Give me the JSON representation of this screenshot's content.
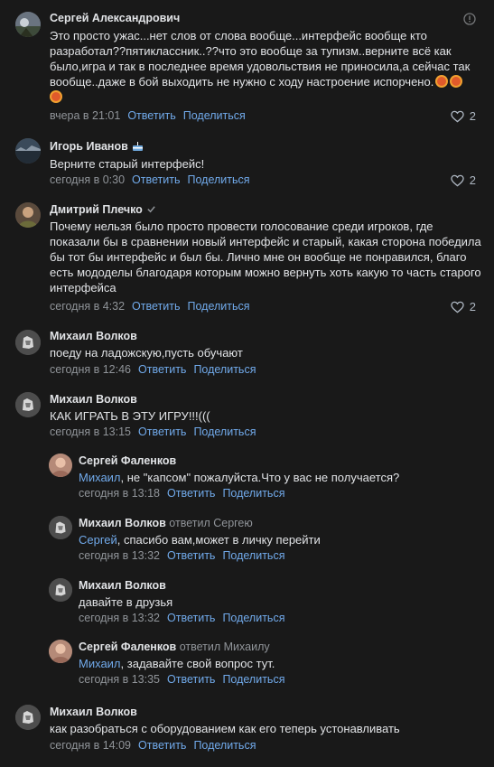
{
  "actions": {
    "reply": "Ответить",
    "share": "Поделиться"
  },
  "comments": [
    {
      "author": "Сергей Александрович",
      "text": "Это просто ужас...нет слов от слова вообще...интерфейс вообще кто разработал??пятиклассник..??что это вообще за тупизм..верните всё как было,игра и так в последнее время удовольствия не приносила,а сейчас так вообще..даже в бой выходить не нужно с ходу настроение испорчено.",
      "time": "вчера в 21:01",
      "likes": "2"
    },
    {
      "author": "Игорь Иванов",
      "text": "Верните старый интерфейс!",
      "time": "сегодня в 0:30",
      "likes": "2"
    },
    {
      "author": "Дмитрий Плечко",
      "text": "Почему нельзя было просто провести голосование среди игроков, где показали бы в сравнении новый интерфейс и старый, какая сторона победила бы тот бы интерфейс и был бы. Лично мне он вообще не понравился, благо есть мододелы благодаря которым можно вернуть хоть какую то часть старого интерфейса",
      "time": "сегодня в 4:32",
      "likes": "2"
    },
    {
      "author": "Михаил Волков",
      "text": "поеду на ладожскую,пусть обучают",
      "time": "сегодня в 12:46"
    },
    {
      "author": "Михаил Волков",
      "text": "КАК ИГРАТЬ В ЭТУ ИГРУ!!!(((",
      "time": "сегодня в 13:15"
    },
    {
      "author": "Сергей Фаленков",
      "mention": "Михаил",
      "text": ", не \"капсом\" пожалуйста.Что у вас не получается?",
      "time": "сегодня в 13:18"
    },
    {
      "author": "Михаил Волков",
      "reply_to": "ответил Сергею",
      "mention": "Сергей",
      "text": ", спасибо вам,может в личку перейти",
      "time": "сегодня в 13:32"
    },
    {
      "author": "Михаил Волков",
      "text": "давайте в друзья",
      "time": "сегодня в 13:32"
    },
    {
      "author": "Сергей Фаленков",
      "reply_to": "ответил Михаилу",
      "mention": "Михаил",
      "text": ", задавайте свой вопрос тут.",
      "time": "сегодня в 13:35"
    },
    {
      "author": "Михаил Волков",
      "text": "как разобраться с оборудованием как его теперь устонавливать",
      "time": "сегодня в 14:09"
    }
  ],
  "colors": {
    "background": "#191919",
    "link": "#71aaeb",
    "secondary": "#909499",
    "text": "#e1e3e6"
  },
  "icons": [
    "more-icon",
    "heart-icon",
    "verified-icon",
    "avatar"
  ]
}
